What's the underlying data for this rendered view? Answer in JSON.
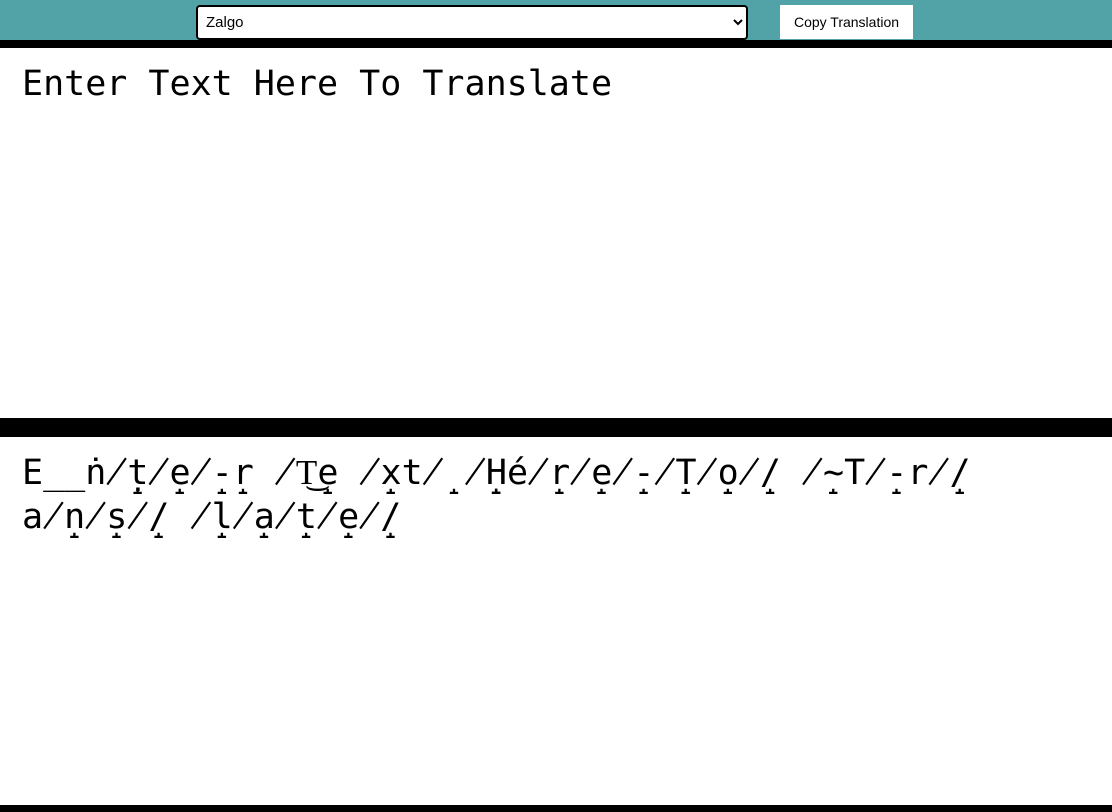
{
  "toolbar": {
    "selected_language": "Zalgo",
    "language_options": [
      "Zalgo"
    ],
    "copy_label": "Copy Translation"
  },
  "input": {
    "text": "Enter Text Here To Translate"
  },
  "output": {
    "text": "E̲̲ṅ̸̝ṭ̸̝e̸̝-r̝ ̸T͜e̝ ̸x̝t̸̝ ̸̝H̝̝é̸̝r̸̝e̸̝-̸̝T̸̝o̸̝/ ̸̝~T̸̝-r̸̝/a̸̝n̸̝s̸̝/ ̸̝l̸̝a̸̝t̸̝e̸̝/"
  },
  "colors": {
    "topbar": "#51a3a8",
    "divider": "#000000",
    "panel": "#ffffff"
  }
}
